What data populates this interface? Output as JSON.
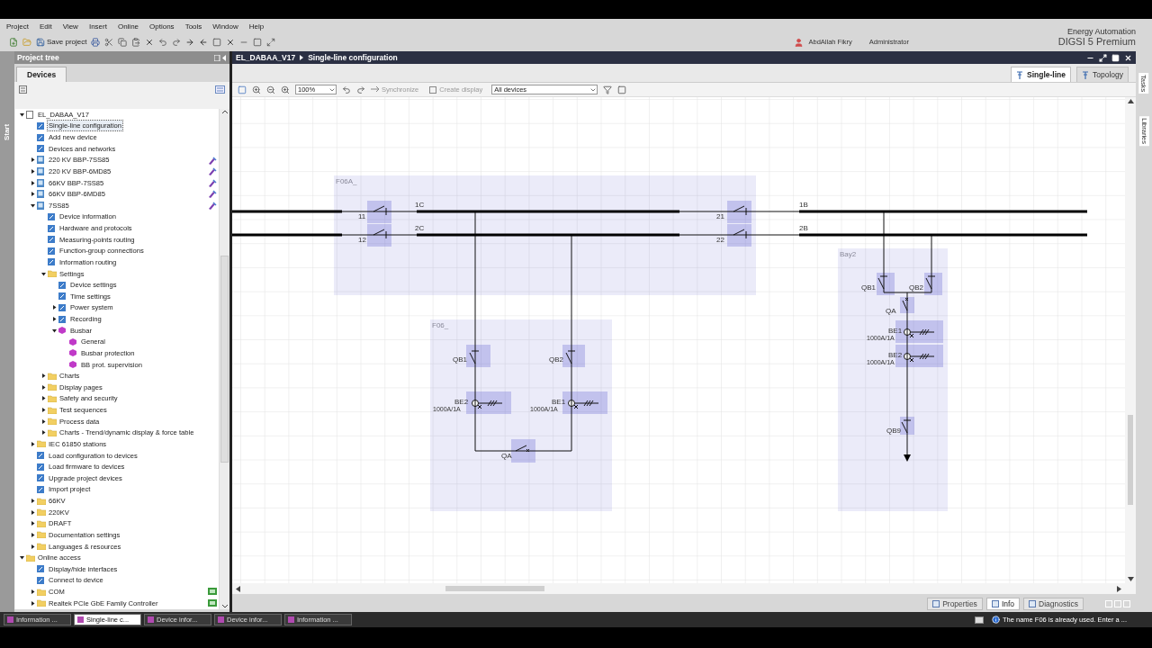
{
  "menu": [
    "Project",
    "Edit",
    "View",
    "Insert",
    "Online",
    "Options",
    "Tools",
    "Window",
    "Help"
  ],
  "toolbar": {
    "save_label": "Save project"
  },
  "user": {
    "name": "AbdAllah Fikry",
    "role": "Administrator"
  },
  "brand": {
    "line1": "Energy Automation",
    "line2": "DIGSI 5 Premium"
  },
  "project_tree": {
    "title": "Project tree",
    "side_label": "Start",
    "tab": "Devices",
    "items": [
      {
        "label": "EL_DABAA_V17",
        "kind": "project",
        "selected": false,
        "expanded": true,
        "children": [
          {
            "label": "Single-line configuration",
            "kind": "page",
            "selected": true
          },
          {
            "label": "Add new device",
            "kind": "page",
            "selected": false
          },
          {
            "label": "Devices and networks",
            "kind": "page",
            "selected": false
          },
          {
            "label": "220 KV BBP-7SS85",
            "kind": "device",
            "selected": false,
            "expanded": false,
            "flagged": true
          },
          {
            "label": "220 KV BBP-6MD85",
            "kind": "device",
            "selected": false,
            "expanded": false,
            "flagged": true
          },
          {
            "label": "66KV BBP-7SS85",
            "kind": "device",
            "selected": false,
            "expanded": false,
            "flagged": true
          },
          {
            "label": "66KV BBP-6MD85",
            "kind": "device",
            "selected": false,
            "expanded": false,
            "flagged": true
          },
          {
            "label": "7SS85",
            "kind": "device",
            "selected": false,
            "expanded": true,
            "flagged": true,
            "children": [
              {
                "label": "Device information",
                "kind": "page",
                "selected": false
              },
              {
                "label": "Hardware and protocols",
                "kind": "page",
                "selected": false
              },
              {
                "label": "Measuring-points routing",
                "kind": "page",
                "selected": false
              },
              {
                "label": "Function-group connections",
                "kind": "page",
                "selected": false
              },
              {
                "label": "Information routing",
                "kind": "page",
                "selected": false
              },
              {
                "label": "Settings",
                "kind": "folder",
                "selected": false,
                "expanded": true,
                "children": [
                  {
                    "label": "Device settings",
                    "kind": "page",
                    "selected": false
                  },
                  {
                    "label": "Time settings",
                    "kind": "page",
                    "selected": false
                  },
                  {
                    "label": "Power system",
                    "kind": "page",
                    "selected": false,
                    "expanded": false
                  },
                  {
                    "label": "Recording",
                    "kind": "page",
                    "selected": false,
                    "expanded": false
                  },
                  {
                    "label": "Busbar",
                    "kind": "function",
                    "selected": false,
                    "expanded": true,
                    "children": [
                      {
                        "label": "General",
                        "kind": "function",
                        "selected": false
                      },
                      {
                        "label": "Busbar protection",
                        "kind": "function",
                        "selected": false
                      },
                      {
                        "label": "BB prot. supervision",
                        "kind": "function",
                        "selected": false
                      }
                    ]
                  }
                ]
              },
              {
                "label": "Charts",
                "kind": "folder",
                "selected": false,
                "expanded": false
              },
              {
                "label": "Display pages",
                "kind": "folder",
                "selected": false,
                "expanded": false
              },
              {
                "label": "Safety and security",
                "kind": "folder",
                "selected": false,
                "expanded": false
              },
              {
                "label": "Test sequences",
                "kind": "folder",
                "selected": false,
                "expanded": false
              },
              {
                "label": "Process data",
                "kind": "folder",
                "selected": false,
                "expanded": false
              },
              {
                "label": "Charts - Trend/dynamic display & force table",
                "kind": "folder",
                "selected": false,
                "expanded": false
              }
            ]
          },
          {
            "label": "IEC 61850 stations",
            "kind": "folder",
            "selected": false,
            "expanded": false
          },
          {
            "label": "Load configuration to devices",
            "kind": "page",
            "selected": false
          },
          {
            "label": "Load firmware to devices",
            "kind": "page",
            "selected": false
          },
          {
            "label": "Upgrade project devices",
            "kind": "page",
            "selected": false
          },
          {
            "label": "Import project",
            "kind": "page",
            "selected": false
          },
          {
            "label": "66KV",
            "kind": "folder",
            "selected": false,
            "expanded": false
          },
          {
            "label": "220KV",
            "kind": "folder",
            "selected": false,
            "expanded": false
          },
          {
            "label": "DRAFT",
            "kind": "folder",
            "selected": false,
            "expanded": false
          },
          {
            "label": "Documentation settings",
            "kind": "folder",
            "selected": false,
            "expanded": false
          },
          {
            "label": "Languages & resources",
            "kind": "folder",
            "selected": false,
            "expanded": false
          }
        ]
      },
      {
        "label": "Online access",
        "kind": "folder",
        "selected": false,
        "expanded": true,
        "children": [
          {
            "label": "Display/hide interfaces",
            "kind": "page",
            "selected": false
          },
          {
            "label": "Connect to device",
            "kind": "page",
            "selected": false
          },
          {
            "label": "COM",
            "kind": "interface",
            "selected": false,
            "expanded": false,
            "flagged": true
          },
          {
            "label": "Realtek PCIe GbE Family Controller",
            "kind": "interface",
            "selected": false,
            "expanded": false,
            "flagged": true
          }
        ]
      }
    ]
  },
  "editor": {
    "breadcrumb": [
      "EL_DABAA_V17",
      "Single-line configuration"
    ],
    "view_tabs": [
      {
        "label": "Single-line",
        "selected": true
      },
      {
        "label": "Topology",
        "selected": false
      }
    ],
    "zoom": "100%",
    "synchronize": {
      "label": "Synchronize",
      "disabled": true
    },
    "create_display": {
      "label": "Create display",
      "disabled": true
    },
    "device_filter": "All devices"
  },
  "diagram": {
    "bays": [
      {
        "label": "F06A_"
      },
      {
        "label": "F06_"
      },
      {
        "label": "Bay2"
      }
    ],
    "busbar_labels": [
      "1C",
      "2C",
      "1B",
      "2B"
    ],
    "devices": [
      {
        "label": "11",
        "kind": "disconnector"
      },
      {
        "label": "12",
        "kind": "disconnector"
      },
      {
        "label": "21",
        "kind": "disconnector"
      },
      {
        "label": "22",
        "kind": "disconnector"
      },
      {
        "label": "QB1",
        "kind": "disconnector"
      },
      {
        "label": "QB2",
        "kind": "disconnector"
      },
      {
        "label": "BE2",
        "kind": "ct",
        "rating": "1000A/1A"
      },
      {
        "label": "BE1",
        "kind": "ct",
        "rating": "1000A/1A"
      },
      {
        "label": "QA",
        "kind": "breaker"
      },
      {
        "label": "QB1",
        "kind": "disconnector"
      },
      {
        "label": "QB2",
        "kind": "disconnector"
      },
      {
        "label": "QA",
        "kind": "breaker"
      },
      {
        "label": "BE1",
        "kind": "ct",
        "rating": "1000A/1A"
      },
      {
        "label": "BE2",
        "kind": "ct",
        "rating": "1000A/1A"
      },
      {
        "label": "QB9",
        "kind": "disconnector"
      }
    ]
  },
  "side_tabs": [
    "Tasks",
    "Libraries"
  ],
  "inspector_tabs": [
    {
      "label": "Properties",
      "selected": false
    },
    {
      "label": "Info",
      "selected": true
    },
    {
      "label": "Diagnostics",
      "selected": false
    }
  ],
  "portal_tabs": [
    {
      "label": "Information ...",
      "selected": false
    },
    {
      "label": "Single-line c...",
      "selected": true
    },
    {
      "label": "Device infor...",
      "selected": false
    },
    {
      "label": "Device infor...",
      "selected": false
    },
    {
      "label": "Information ...",
      "selected": false
    }
  ],
  "status_message": "The name F06 is already used. Enter a ..."
}
